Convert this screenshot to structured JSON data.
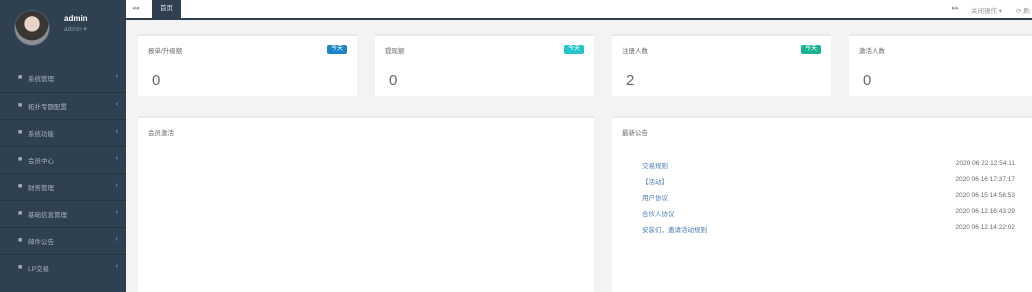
{
  "profile": {
    "name": "admin",
    "role": "admin ▾"
  },
  "sidebar": {
    "items": [
      {
        "label": "系统管理"
      },
      {
        "label": "拓扑专题配置"
      },
      {
        "label": "系统功能"
      },
      {
        "label": "会员中心"
      },
      {
        "label": "财务管理"
      },
      {
        "label": "基础信息管理"
      },
      {
        "label": "邮件公告"
      },
      {
        "label": "LP交易"
      }
    ]
  },
  "tabs": {
    "back": "◂◂",
    "active": "首页",
    "forward": "▸▸",
    "close": "关闭操作 ▾",
    "refresh": "⟳ 刷"
  },
  "stats": [
    {
      "title": "报单/升级额",
      "badge": "今天",
      "badge_color": "#1c84c6",
      "value": "0"
    },
    {
      "title": "提现额",
      "badge": "今天",
      "badge_color": "#23c6c8",
      "value": "0"
    },
    {
      "title": "注册人数",
      "badge": "今天",
      "badge_color": "#1ab394",
      "value": "2"
    },
    {
      "title": "激活人数",
      "badge": "",
      "badge_color": "",
      "value": "0"
    }
  ],
  "panels": {
    "left_title": "会员激活",
    "right_title": "最新公告",
    "notices": [
      {
        "title": "交易规则",
        "time": "2020 06 22 12:54:11"
      },
      {
        "title": "【活动】",
        "time": "2020 06 16 17:37:17"
      },
      {
        "title": "用户协议",
        "time": "2020 06 15 14:56:53"
      },
      {
        "title": "合伙人协议",
        "time": "2020 06 12 16:43:29"
      },
      {
        "title": "安装们，邀请活动规则",
        "time": "2020 06 12 14:22:02"
      }
    ]
  }
}
